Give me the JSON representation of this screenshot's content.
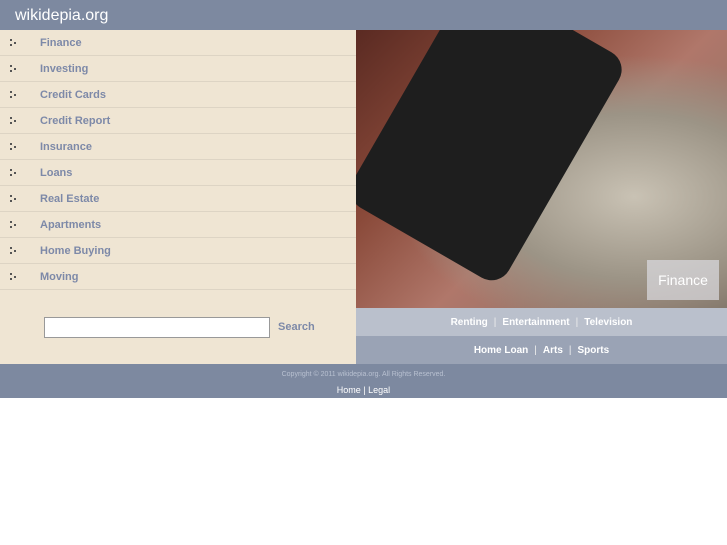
{
  "header": {
    "title": "wikidepia.org"
  },
  "sidebar": {
    "items": [
      {
        "label": "Finance"
      },
      {
        "label": "Investing"
      },
      {
        "label": "Credit Cards"
      },
      {
        "label": "Credit Report"
      },
      {
        "label": "Insurance"
      },
      {
        "label": "Loans"
      },
      {
        "label": "Real Estate"
      },
      {
        "label": "Apartments"
      },
      {
        "label": "Home Buying"
      },
      {
        "label": "Moving"
      }
    ]
  },
  "search": {
    "value": "",
    "button_label": "Search"
  },
  "photo": {
    "caption": "Finance"
  },
  "links_row1": [
    "Renting",
    "Entertainment",
    "Television"
  ],
  "links_row2": [
    "Home Loan",
    "Arts",
    "Sports"
  ],
  "footer": {
    "copyright": "Copyright © 2011 wikidepia.org. All Rights Reserved.",
    "links": [
      "Home",
      "Legal"
    ]
  },
  "colors": {
    "header": "#7d89a0",
    "sidebar": "#efe5d3",
    "link_text": "#7d89a8"
  }
}
